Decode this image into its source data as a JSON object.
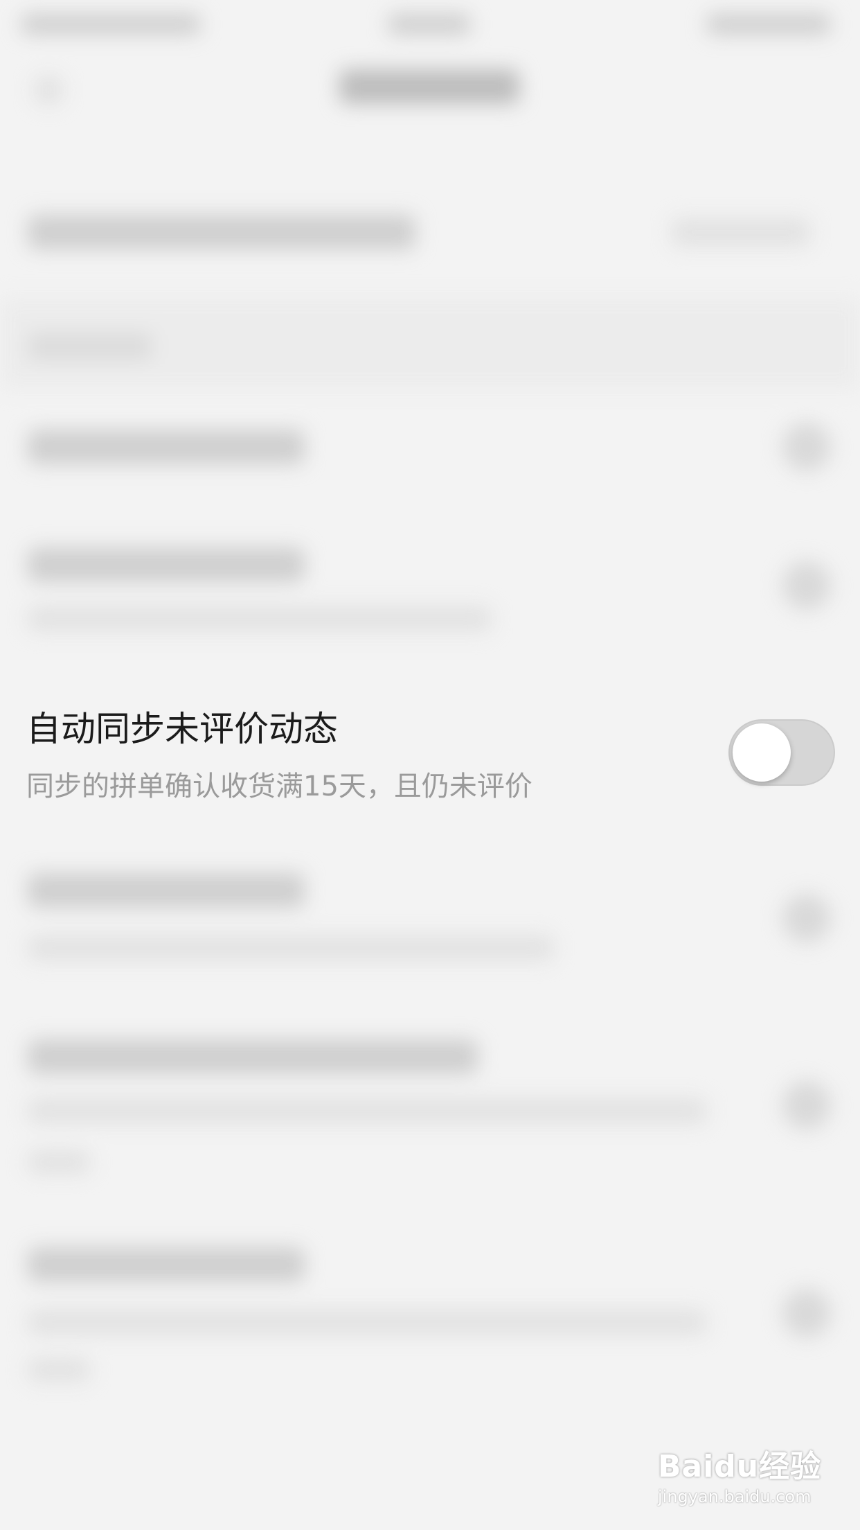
{
  "setting": {
    "title": "自动同步未评价动态",
    "subtitle": "同步的拼单确认收货满15天，且仍未评价",
    "toggle_on": false
  },
  "watermark": {
    "logo": "Baidu经验",
    "url": "jingyan.baidu.com"
  },
  "colors": {
    "background": "#f3f3f3",
    "title_text": "#1b1b1b",
    "subtitle_text": "#9a9a9a",
    "toggle_off_track": "#d6d6d6",
    "toggle_knob": "#ffffff"
  }
}
